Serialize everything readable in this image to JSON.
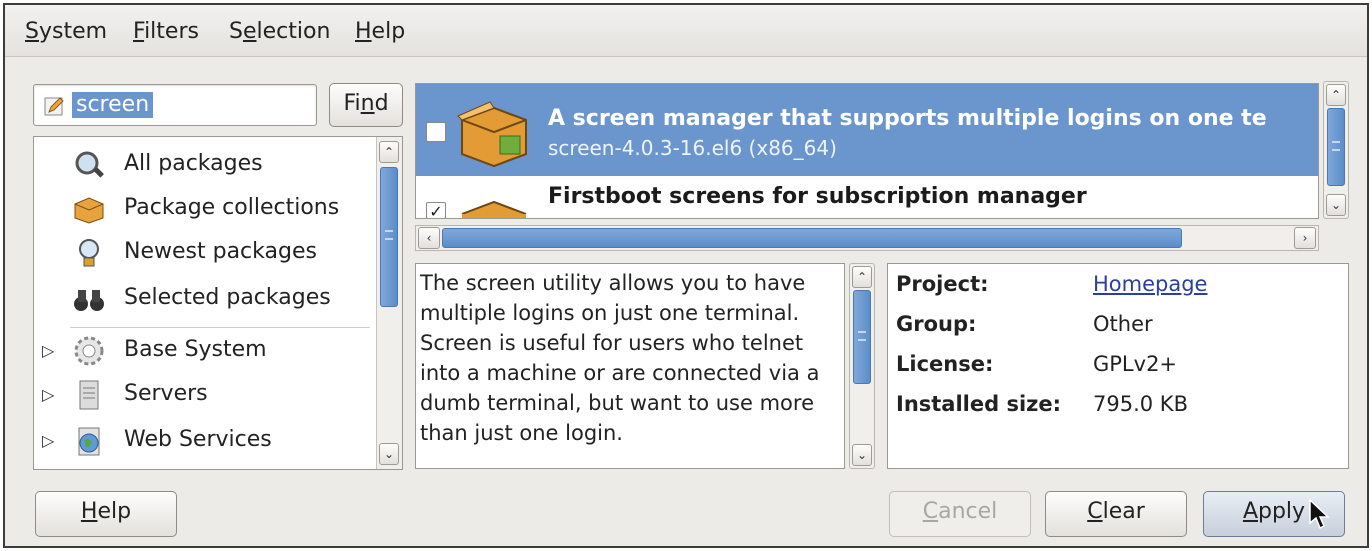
{
  "menu": [
    "System",
    "Filters",
    "Selection",
    "Help"
  ],
  "search": {
    "value": "screen",
    "find_label": "Find"
  },
  "tree": {
    "views": [
      "All packages",
      "Package collections",
      "Newest packages",
      "Selected packages"
    ],
    "groups": [
      "Base System",
      "Servers",
      "Web Services"
    ]
  },
  "packages": [
    {
      "summary": "A screen manager that supports multiple logins on one te",
      "name": "screen-4.0.3-16.el6 (x86_64)",
      "checked": false,
      "selected": true
    },
    {
      "summary": "Firstboot screens for subscription manager",
      "checked": true,
      "selected": false
    }
  ],
  "description": "The screen utility allows you to have multiple logins on just one terminal. Screen is useful for users who telnet into a machine or are connected via a dumb terminal, but want to use more than just one login.",
  "details": {
    "project_label": "Project:",
    "project_value": "Homepage",
    "group_label": "Group:",
    "group_value": "Other",
    "license_label": "License:",
    "license_value": "GPLv2+",
    "size_label": "Installed size:",
    "size_value": "795.0 KB"
  },
  "buttons": {
    "help": "Help",
    "cancel": "Cancel",
    "clear": "Clear",
    "apply": "Apply"
  },
  "colors": {
    "selection": "#6b96cd",
    "window_bg": "#ecebe8",
    "link": "#2a3f9e"
  }
}
